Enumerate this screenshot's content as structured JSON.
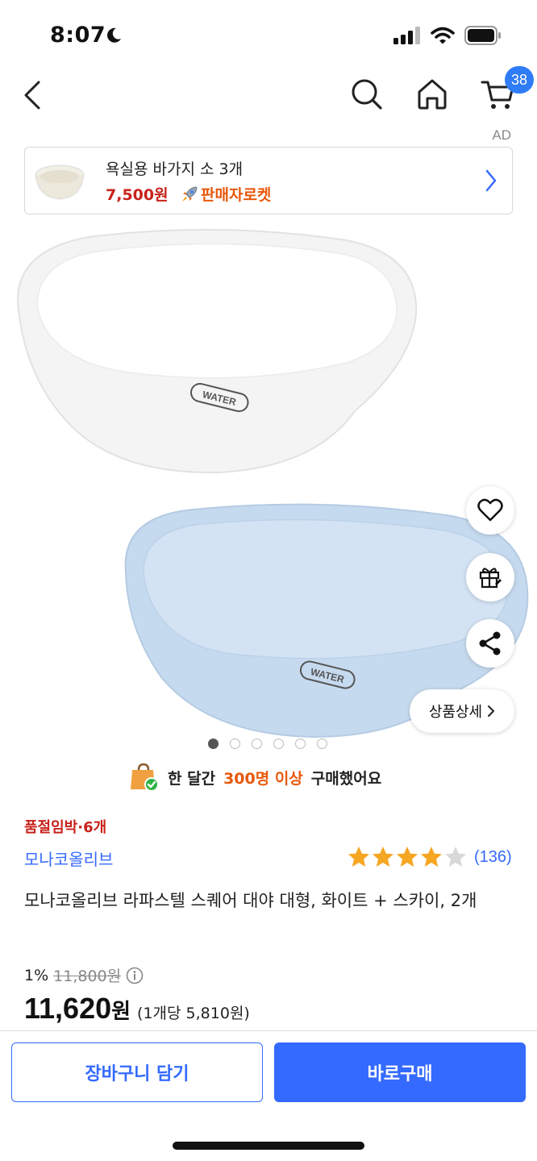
{
  "status_bar": {
    "time": "8:07"
  },
  "nav": {
    "cart_count": "38"
  },
  "ad": {
    "label": "AD",
    "title": "욕실용 바가지 소 3개",
    "price": "7,500원",
    "rocket_label": "판매자로켓"
  },
  "gallery": {
    "image_count": 6,
    "active_index": 0,
    "logo_text": "WATER",
    "colors": {
      "white_basin": "#f6f6f6",
      "sky_basin": "#c9dcf0"
    }
  },
  "actions": {
    "detail_label": "상품상세"
  },
  "buyers": {
    "prefix": "한 달간",
    "highlight": "300명 이상",
    "suffix": "구매했어요"
  },
  "product": {
    "stock_warning": "품절임박·6개",
    "brand": "모나코올리브",
    "rating": 4.5,
    "review_count": "(136)",
    "title": "모나코올리브 라파스텔 스퀘어 대야 대형, 화이트 + 스카이, 2개",
    "discount": "1%",
    "original_price": "11,800원",
    "sale_price": "11,620",
    "sale_currency": "원",
    "unit_price": "(1개당 5,810원)"
  },
  "buttons": {
    "add_to_cart": "장바구니 담기",
    "buy_now": "바로구매"
  },
  "colors": {
    "accent": "#346aff",
    "warning": "#c8221b",
    "highlight": "#e8590c",
    "star": "#f5a623"
  }
}
